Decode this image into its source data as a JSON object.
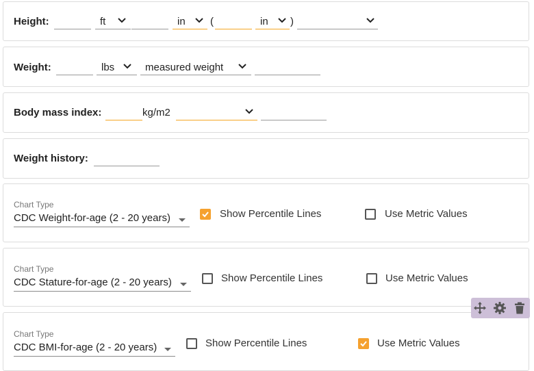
{
  "height": {
    "label": "Height:",
    "ft_unit": "ft",
    "in_unit": "in",
    "paren_open": "(",
    "paren_unit": "in",
    "paren_close": ")"
  },
  "weight": {
    "label": "Weight:",
    "unit": "lbs",
    "method": "measured weight"
  },
  "bmi": {
    "label": "Body mass index:",
    "unit": "kg/m2"
  },
  "history": {
    "label": "Weight history:"
  },
  "charts": [
    {
      "caption": "Chart Type",
      "type": "CDC Weight-for-age (2 - 20 years)",
      "percentile_label": "Show Percentile Lines",
      "percentile_checked": true,
      "metric_label": "Use Metric Values",
      "metric_checked": false
    },
    {
      "caption": "Chart Type",
      "type": "CDC Stature-for-age (2 - 20 years)",
      "percentile_label": "Show Percentile Lines",
      "percentile_checked": false,
      "metric_label": "Use Metric Values",
      "metric_checked": false
    },
    {
      "caption": "Chart Type",
      "type": "CDC BMI-for-age (2 - 20 years)",
      "percentile_label": "Show Percentile Lines",
      "percentile_checked": false,
      "metric_label": "Use Metric Values",
      "metric_checked": true
    }
  ],
  "toolbar": {
    "icons": [
      "move-icon",
      "gear-icon",
      "trash-icon"
    ]
  },
  "colors": {
    "accent": "#f5a12f",
    "toolbar_bg": "#cdbfd8",
    "border": "#dcdcdc"
  }
}
